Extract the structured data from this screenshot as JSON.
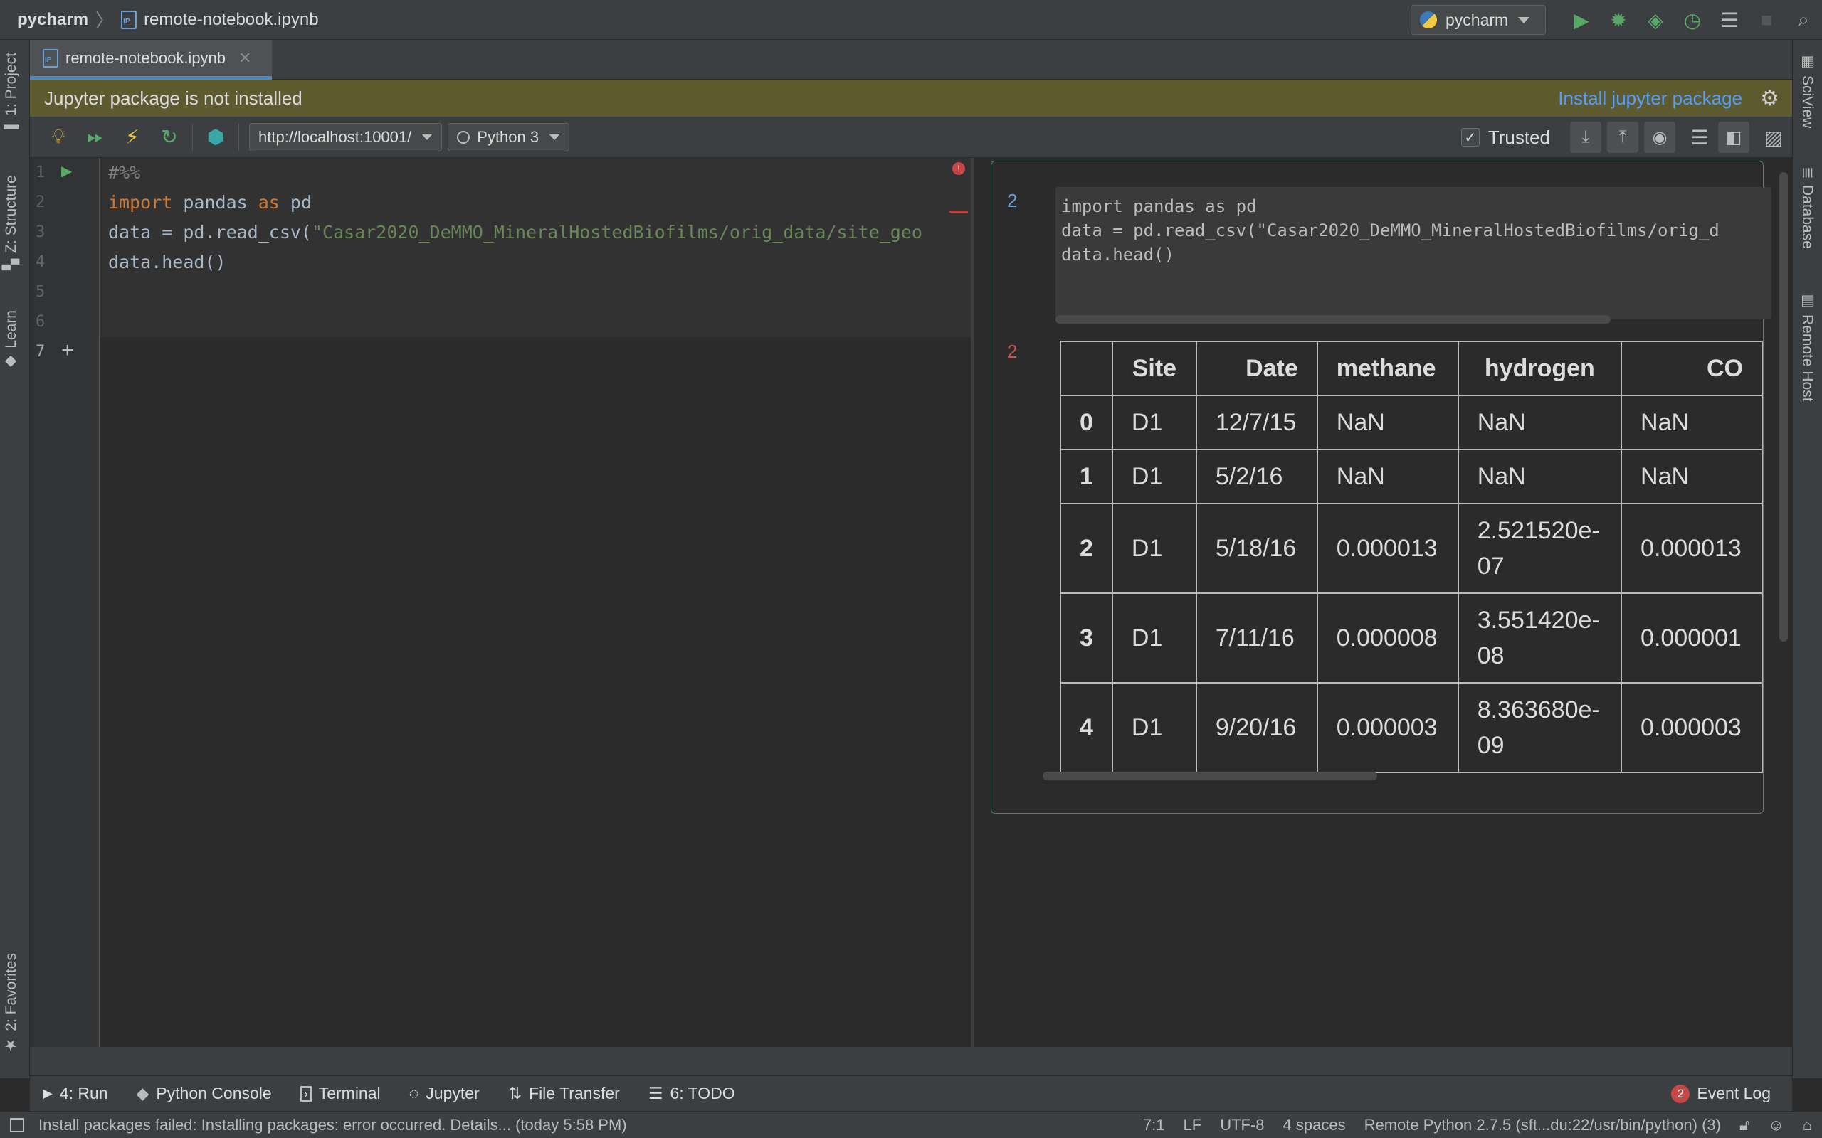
{
  "titlebar": {
    "project": "pycharm",
    "file": "remote-notebook.ipynb",
    "run_config": "pycharm"
  },
  "left_tabs": {
    "project": "1: Project",
    "structure": "Z: Structure",
    "learn": "Learn",
    "favorites": "2: Favorites"
  },
  "right_tabs": {
    "sciview": "SciView",
    "database": "Database",
    "remote_host": "Remote Host"
  },
  "editor_tab": {
    "label": "remote-notebook.ipynb"
  },
  "notification": {
    "message": "Jupyter package is not installed",
    "action": "Install jupyter package"
  },
  "jupyter_toolbar": {
    "server": "http://localhost:10001/",
    "kernel": "Python 3",
    "trusted": "Trusted"
  },
  "editor": {
    "line_numbers": [
      "1",
      "2",
      "3",
      "4",
      "5",
      "6",
      "7"
    ],
    "lines": {
      "l1": "#%%",
      "l2_kw": "import",
      "l2_mod": " pandas ",
      "l2_kw2": "as",
      "l2_alias": " pd",
      "l3_pre": "data = pd.read_csv(",
      "l3_str": "\"Casar2020_DeMMO_MineralHostedBiofilms/orig_data/site_geo",
      "l4": "data.head()"
    }
  },
  "preview": {
    "input_number": "2",
    "output_number": "2",
    "code_lines": [
      "import pandas as pd",
      "data = pd.read_csv(\"Casar2020_DeMMO_MineralHostedBiofilms/orig_d",
      "data.head()"
    ],
    "table": {
      "columns": [
        "",
        "Site",
        "Date",
        "methane",
        "hydrogen",
        "CO"
      ],
      "rows": [
        [
          "0",
          "D1",
          "12/7/15",
          "NaN",
          "NaN",
          "NaN"
        ],
        [
          "1",
          "D1",
          "5/2/16",
          "NaN",
          "NaN",
          "NaN"
        ],
        [
          "2",
          "D1",
          "5/18/16",
          "0.000013",
          "2.521520e-07",
          "0.000013"
        ],
        [
          "3",
          "D1",
          "7/11/16",
          "0.000008",
          "3.551420e-08",
          "0.000001"
        ],
        [
          "4",
          "D1",
          "9/20/16",
          "0.000003",
          "8.363680e-09",
          "0.000003"
        ]
      ]
    }
  },
  "tool_windows": {
    "run": "4: Run",
    "python_console": "Python Console",
    "terminal": "Terminal",
    "jupyter": "Jupyter",
    "file_transfer": "File Transfer",
    "todo": "6: TODO",
    "event_log": "Event Log",
    "event_count": "2"
  },
  "status": {
    "message": "Install packages failed: Installing packages: error occurred. Details... (today 5:58 PM)",
    "position": "7:1",
    "line_sep": "LF",
    "encoding": "UTF-8",
    "indent": "4 spaces",
    "interpreter": "Remote Python 2.7.5 (sft...du:22/usr/bin/python) (3)"
  }
}
